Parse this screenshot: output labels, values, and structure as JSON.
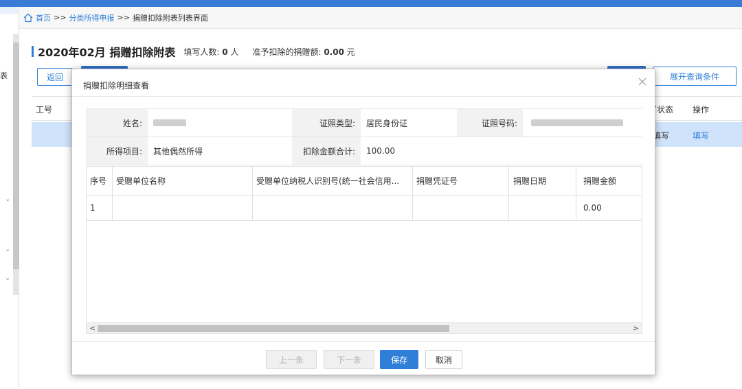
{
  "breadcrumb": {
    "home": "首页",
    "sep": ">>",
    "section": "分类所得申报",
    "current": "捐赠扣除附表列表界面"
  },
  "leftnav": {
    "edge_char": "表"
  },
  "page": {
    "title": "2020年02月  捐赠扣除附表",
    "filled_label": "填写人数:",
    "filled_value": "0",
    "filled_unit": "人",
    "deduct_label": "准予扣除的捐赠额:",
    "deduct_value": "0.00",
    "deduct_unit": "元",
    "back_button": "返回",
    "expand_button": "展开查询条件"
  },
  "bg_table": {
    "headers": {
      "col1": "工号",
      "status": "写状态",
      "action": "操作"
    },
    "row": {
      "status": "填写",
      "action": "填写"
    }
  },
  "modal": {
    "title": "捐赠扣除明细查看",
    "info": {
      "name_label": "姓名:",
      "id_type_label": "证照类型:",
      "id_type_value": "居民身份证",
      "id_no_label": "证照号码:",
      "income_item_label": "所得项目:",
      "income_item_value": "其他偶然所得",
      "deduct_total_label": "扣除金额合计:",
      "deduct_total_value": "100.00"
    },
    "grid": {
      "headers": [
        "序号",
        "受赠单位名称",
        "受赠单位纳税人识别号(统一社会信用...",
        "捐赠凭证号",
        "捐赠日期",
        "捐赠金额"
      ],
      "rows": [
        [
          "1",
          "",
          "",
          "",
          "",
          "0.00"
        ]
      ]
    },
    "footer": {
      "prev": "上一条",
      "next": "下一条",
      "save": "保存",
      "cancel": "取消"
    }
  },
  "colors": {
    "accent": "#2f7fd8",
    "row_highlight": "#cfe3fb"
  }
}
